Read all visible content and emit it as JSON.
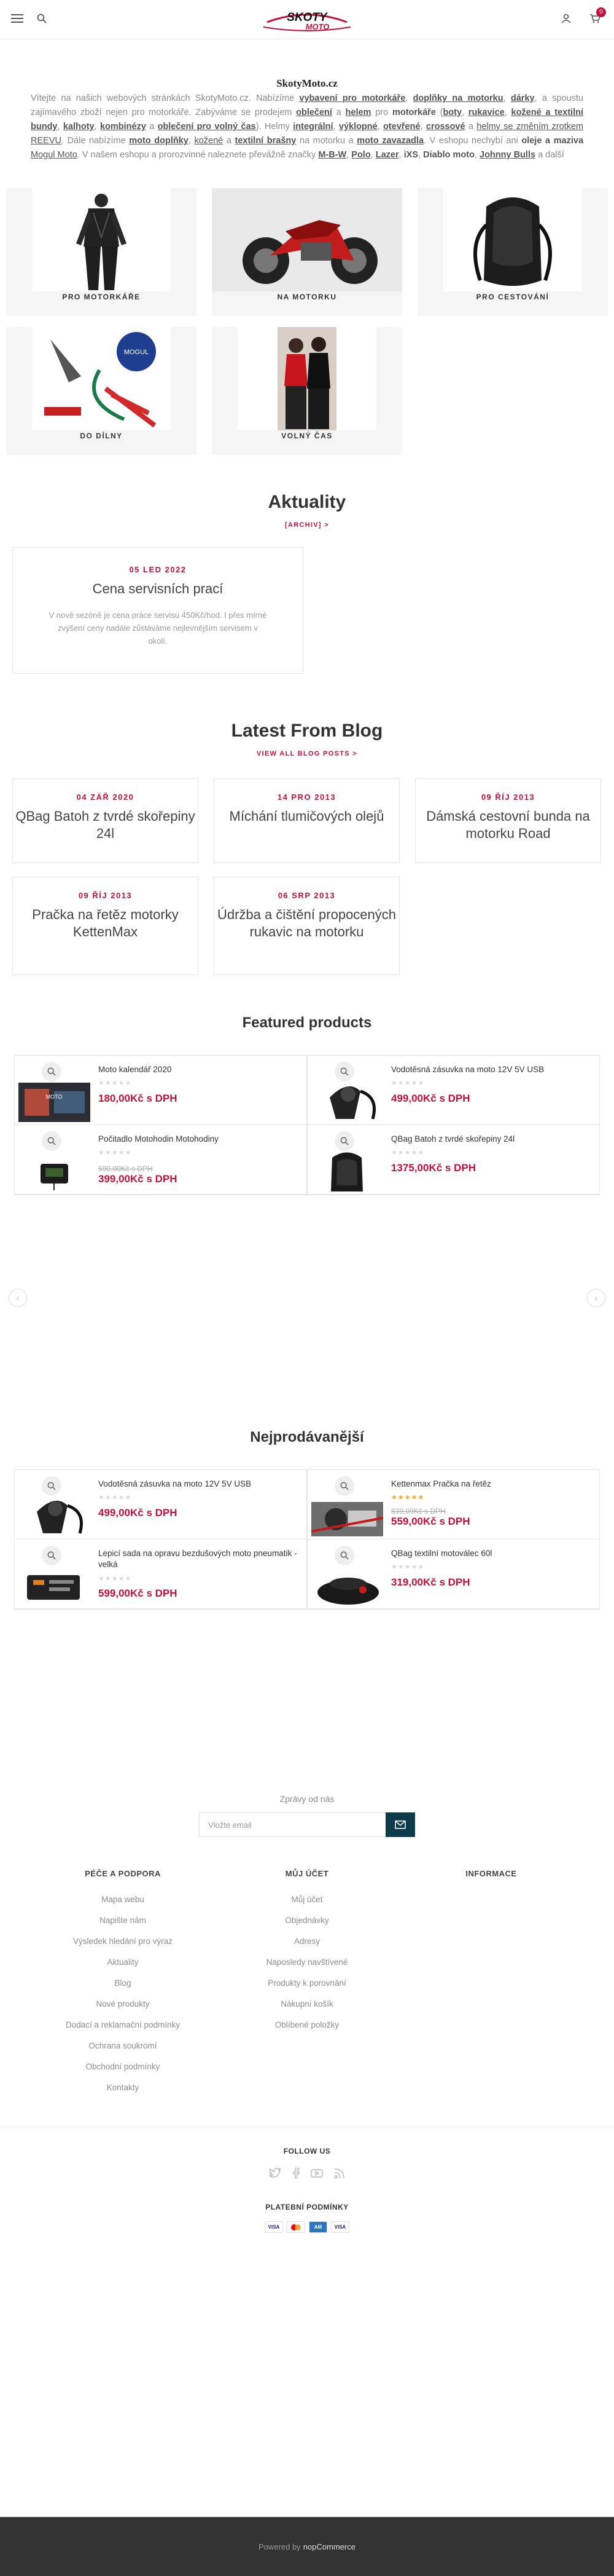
{
  "header": {
    "menu_icon": "hamburger-icon",
    "search_icon": "search-icon",
    "logo_text": "Skoty Moto",
    "account_icon": "user-icon",
    "cart_icon": "cart-icon",
    "cart_count": "0"
  },
  "intro": {
    "title": "SkotyMoto.cz",
    "p1": "Vítejte na našich webových stránkách SkotyMoto.cz. Nabízíme ",
    "l1": "vybavení pro motorkáře",
    "p2": ", ",
    "l2": "doplňky na motorku",
    "p3": ", ",
    "l3": "dárky",
    "p4": ", a spoustu zajímavého zboží nejen pro motorkáře. Zabýváme se prodejem ",
    "l4": "oblečení",
    "p5": " a ",
    "l5": "helem",
    "p6": " pro ",
    "l6": "motorkáře",
    "p7": " (",
    "l7": "boty",
    "p8": ", ",
    "l8": "rukavice",
    "p9": ", ",
    "l9": "kožené a textilní bundy",
    "p10": ", ",
    "l10": "kalhoty",
    "p11": ", ",
    "l11": "kombinézy",
    "p12": " a ",
    "l12": "oblečení pro volný čas",
    "p13": "). Helmy ",
    "l13": "integrální",
    "p14": ", ",
    "l14": "výklopné",
    "p15": ", ",
    "l15": "otevřené",
    "p16": ", ",
    "l16": "crossové",
    "p17": " a ",
    "l17": "helmy se zrněním zrotkem REEVU",
    "p18": ". Dále nabízíme ",
    "l18": "moto doplňky",
    "p19": ", ",
    "l19": "kožené",
    "p20": " a ",
    "l20": "textilní brašny",
    "p21": " na motorku a ",
    "l21": "moto zavazadla",
    "p22": ". V eshopu nechybí ani ",
    "l22": "oleje a maziva",
    "p23": " ",
    "l23": "Mogul Moto",
    "p24": ". V našem eshopu a prorozvinné naleznete převážně značky ",
    "l24": "M-B-W",
    "p25": ", ",
    "l25": "Polo",
    "p26": ", ",
    "l26": "Lazer",
    "p27": ", ",
    "l27": "iXS",
    "p28": ", ",
    "l28": "Diablo moto",
    "p29": ", ",
    "l29": "Johnny Bulls",
    "p30": " a další"
  },
  "categories": [
    {
      "label": "PRO MOTORKÁŘE"
    },
    {
      "label": "NA MOTORKU"
    },
    {
      "label": "PRO CESTOVÁNÍ"
    },
    {
      "label": "DO DÍLNY"
    },
    {
      "label": "VOLNÝ ČAS"
    }
  ],
  "news": {
    "title": "Aktuality",
    "archive": "[ARCHIV] >",
    "items": [
      {
        "date": "05 LED 2022",
        "title": "Cena servisních prací",
        "body": "V nové sezóně je cena práce servisu 450Kč/hod. I přes mírné zvýšení ceny nadále zůstáváme nejlevnějším servisem v okolí."
      }
    ]
  },
  "blog": {
    "title": "Latest From Blog",
    "view_all": "VIEW ALL BLOG POSTS >",
    "posts": [
      {
        "date": "04 ZÁŘ 2020",
        "title": "QBag Batoh z tvrdé skořepiny 24l"
      },
      {
        "date": "14 PRO 2013",
        "title": "Míchání tlumičových olejů"
      },
      {
        "date": "09 ŘÍJ 2013",
        "title": "Dámská cestovní bunda na motorku Road"
      },
      {
        "date": "09 ŘÍJ 2013",
        "title": "Pračka na řetěz motorky KettenMax"
      },
      {
        "date": "06 SRP 2013",
        "title": "Údržba a čištění propocených rukavic na motorku"
      }
    ]
  },
  "featured": {
    "title": "Featured products",
    "items": [
      {
        "name": "Moto kalendář 2020",
        "stars": "★★★★★",
        "old_price": "",
        "price": "180,00Kč s DPH"
      },
      {
        "name": "Vodotěsná zásuvka na moto 12V 5V USB",
        "stars": "★★★★★",
        "old_price": "",
        "price": "499,00Kč s DPH"
      },
      {
        "name": "Počitadlo Motohodin Motohodiny",
        "stars": "★★★★★",
        "old_price": "590,00Kč s DPH",
        "price": "399,00Kč s DPH"
      },
      {
        "name": "QBag Batoh z tvrdé skořepiny 24l",
        "stars": "★★★★★",
        "old_price": "",
        "price": "1375,00Kč s DPH"
      }
    ]
  },
  "carousel": {
    "prev": "‹",
    "next": "›"
  },
  "bestsellers": {
    "title": "Nejprodávanější",
    "items": [
      {
        "name": "Vodotěsná zásuvka na moto 12V 5V USB",
        "stars": "★★★★★",
        "old_price": "",
        "price": "499,00Kč s DPH"
      },
      {
        "name": "Kettenmax Pračka na řetěz",
        "stars": "★★★★★",
        "old_price": "839,00Kč s DPH",
        "price": "559,00Kč s DPH"
      },
      {
        "name": "Lepicí sada na opravu bezdušových moto pneumatik - velká",
        "stars": "★★★★★",
        "old_price": "",
        "price": "599,00Kč s DPH"
      },
      {
        "name": "QBag textilní motoválec 60l",
        "stars": "★★★★★",
        "old_price": "",
        "price": "319,00Kč s DPH"
      }
    ]
  },
  "newsletter": {
    "title": "Zprávy od nás",
    "placeholder": "Vložte email"
  },
  "footer": {
    "col1": {
      "title": "PÉČE A PODPORA",
      "items": [
        "Mapa webu",
        "Napište nám",
        "Výsledek hledání pro výraz",
        "Aktuality",
        "Blog",
        "Nové produkty",
        "Dodací a reklamační podmínky",
        "Ochrana soukromí",
        "Obchodní podmínky",
        "Kontakty"
      ]
    },
    "col2": {
      "title": "MŮJ ÚČET",
      "items": [
        "Můj účet",
        "Objednávky",
        "Adresy",
        "Naposledy navštívené",
        "Produkty k porovnání",
        "Nákupní košík",
        "Oblíbené položky"
      ]
    },
    "col3": {
      "title": "INFORMACE",
      "items": []
    },
    "follow_title": "FOLLOW US",
    "payment_title": "PLATEBNÍ PODMÍNKY",
    "powered": "Powered by",
    "powered_brand": "nopCommerce"
  },
  "colors": {
    "accent": "#c3103b",
    "dark": "#333333",
    "newsletter_button": "#0e3b4a"
  }
}
